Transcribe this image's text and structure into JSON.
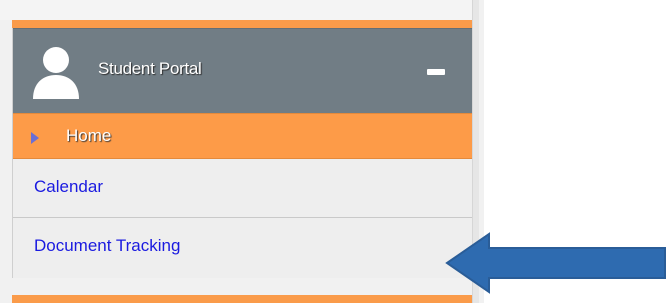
{
  "sidebar": {
    "header": {
      "title": "Student Portal",
      "icon": "user-icon",
      "collapse_icon": "minus-icon"
    },
    "items": [
      {
        "label": "Home",
        "icon": "chevron-right-icon",
        "active": true
      },
      {
        "label": "Calendar"
      },
      {
        "label": "Document Tracking"
      }
    ]
  },
  "annotation": {
    "icon": "arrow-left-icon",
    "color": "#2e6bb0"
  },
  "colors": {
    "accent": "#fd9b48",
    "header_bg": "#717d85",
    "link": "#1a1ae0"
  }
}
